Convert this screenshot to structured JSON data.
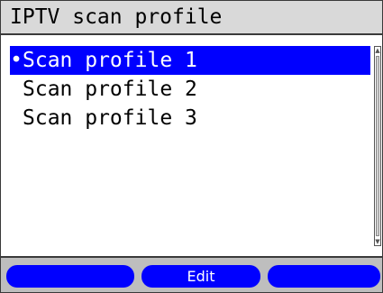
{
  "header": {
    "title": "IPTV scan profile"
  },
  "list": {
    "items": [
      {
        "marker": "•",
        "label": "Scan profile 1",
        "selected": true
      },
      {
        "marker": " ",
        "label": "Scan profile 2",
        "selected": false
      },
      {
        "marker": " ",
        "label": "Scan profile 3",
        "selected": false
      }
    ]
  },
  "softkeys": {
    "left_label": "",
    "middle_label": "Edit",
    "right_label": ""
  },
  "colors": {
    "selection": "#0000ff",
    "softkey": "#0000ff",
    "titlebar": "#d9d9d9",
    "footer": "#bebebe"
  },
  "icons": {
    "active_marker": "bullet",
    "scroll_up": "triangle-up",
    "scroll_down": "triangle-down"
  }
}
